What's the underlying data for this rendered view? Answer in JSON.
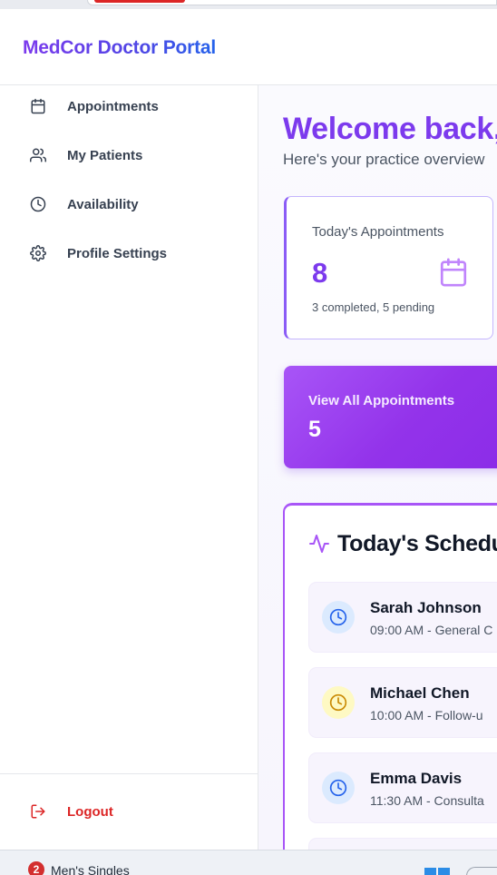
{
  "browser": {
    "taskbar": {
      "notification_count": "2",
      "label": "Men's Singles"
    }
  },
  "header": {
    "brand": "MedCor Doctor Portal"
  },
  "sidebar": {
    "items": [
      {
        "label": "Appointments",
        "icon": "calendar-icon"
      },
      {
        "label": "My Patients",
        "icon": "users-icon"
      },
      {
        "label": "Availability",
        "icon": "clock-icon"
      },
      {
        "label": "Profile Settings",
        "icon": "gear-icon"
      }
    ],
    "logout": {
      "label": "Logout",
      "icon": "logout-icon"
    }
  },
  "main": {
    "welcome": "Welcome back,",
    "subtitle": "Here's your practice overview",
    "stat_card": {
      "title": "Today's Appointments",
      "value": "8",
      "subtext": "3 completed, 5 pending",
      "icon": "calendar-icon"
    },
    "view_all_card": {
      "title": "View All Appointments",
      "value": "5"
    },
    "schedule": {
      "title": "Today's Schedu",
      "icon": "activity-icon",
      "appointments": [
        {
          "name": "Sarah Johnson",
          "time": "09:00 AM - General C",
          "status_color": "#2563eb"
        },
        {
          "name": "Michael Chen",
          "time": "10:00 AM - Follow-u",
          "status_color": "#ca8a04"
        },
        {
          "name": "Emma Davis",
          "time": "11:30 AM - Consulta",
          "status_color": "#2563eb"
        }
      ]
    }
  },
  "colors": {
    "accent": "#7c3aed",
    "accent_light": "#a855f7",
    "danger": "#dc2626"
  }
}
